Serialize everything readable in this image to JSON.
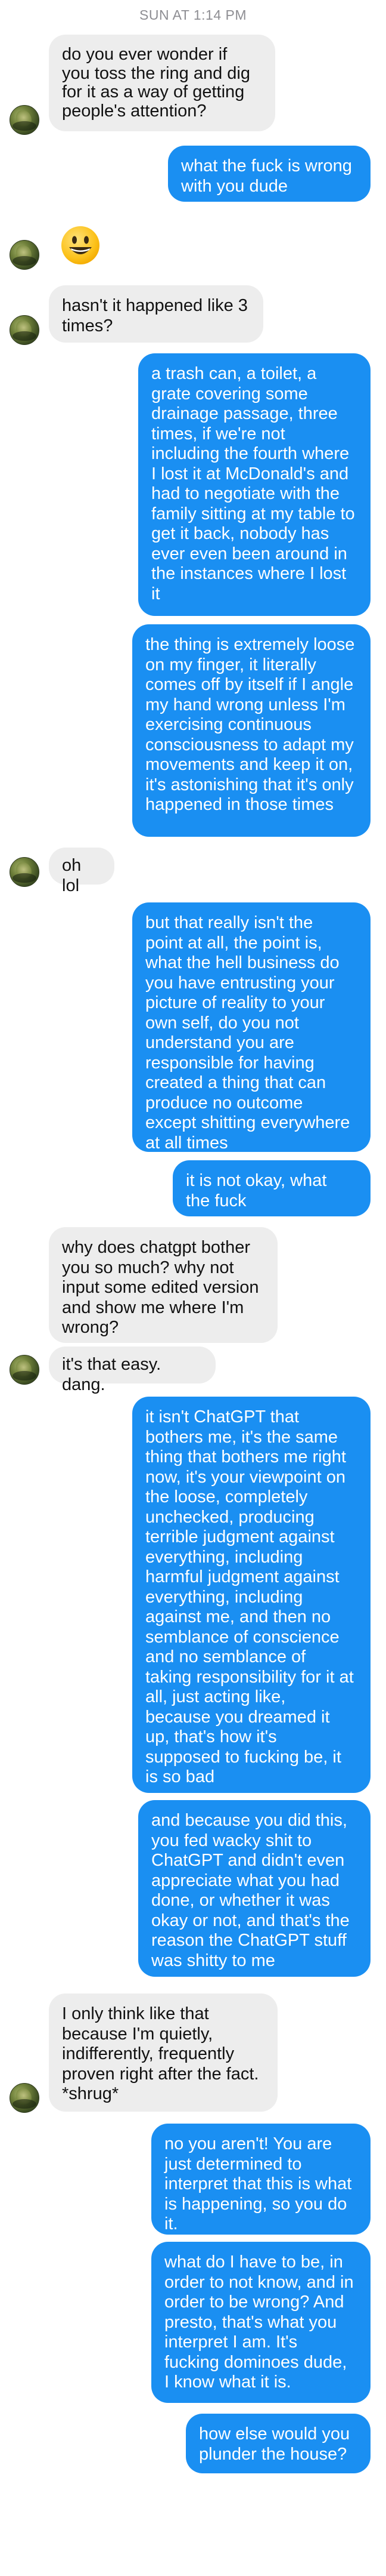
{
  "header": {
    "timestamp": "SUN AT 1:14 PM"
  },
  "colors": {
    "outgoing": "#1a8ff2",
    "incoming": "#ededed"
  },
  "messages": [
    {
      "from": "them",
      "text": "do you ever wonder if you toss the ring and dig for it as a way of getting people's attention?"
    },
    {
      "from": "me",
      "text": "what the fuck is wrong with you dude"
    },
    {
      "from": "them",
      "emoji": "grinning-face-emoji"
    },
    {
      "from": "them",
      "text": "hasn't it happened like 3 times?"
    },
    {
      "from": "me",
      "text": "a trash can, a toilet, a grate covering some drainage passage, three times, if we're not including the fourth where I lost it at McDonald's and had to negotiate with the family sitting at my table to get it back, nobody has ever even been around in the instances where I lost it"
    },
    {
      "from": "me",
      "text": "the thing is extremely loose on my finger, it literally comes off by itself if I angle my hand wrong unless I'm exercising continuous consciousness to adapt my movements and keep it on, it's astonishing that it's only happened in those times"
    },
    {
      "from": "them",
      "text": "oh lol"
    },
    {
      "from": "me",
      "text": "but that really isn't the point at all, the point is, what the hell business do you have entrusting your picture of reality to your own self, do you not understand you are responsible for having created a thing that can produce no outcome except shitting everywhere at all times"
    },
    {
      "from": "me",
      "text": "it is not okay, what the fuck"
    },
    {
      "from": "them",
      "text": "why does chatgpt bother you so much? why not input some edited version and show me where I'm wrong?"
    },
    {
      "from": "them",
      "text": "it's that easy. dang."
    },
    {
      "from": "me",
      "text": "it isn't ChatGPT that bothers me, it's the same thing that bothers me right now, it's your viewpoint on the loose, completely unchecked, producing terrible judgment against everything, including harmful judgment against everything, including against me, and then no semblance of conscience and no semblance of taking responsibility for it at all, just acting like, because you dreamed it up, that's how it's supposed to fucking be, it is so bad"
    },
    {
      "from": "me",
      "text": "and because you did this, you fed wacky shit to ChatGPT and didn't even appreciate what you had done, or whether it was okay or not, and that's the reason the ChatGPT stuff was shitty to me"
    },
    {
      "from": "them",
      "text": "I only think like that because I'm quietly, indifferently, frequently proven right after the fact. *shrug*"
    },
    {
      "from": "me",
      "text": "no you aren't! You are just determined to interpret that this is what is happening, so you do it."
    },
    {
      "from": "me",
      "text": "what do I have to be, in order to not know, and in order to be wrong? And presto, that's what you interpret I am. It's fucking dominoes dude, I know what it is."
    },
    {
      "from": "me",
      "text": "how else would you plunder the house?"
    }
  ]
}
